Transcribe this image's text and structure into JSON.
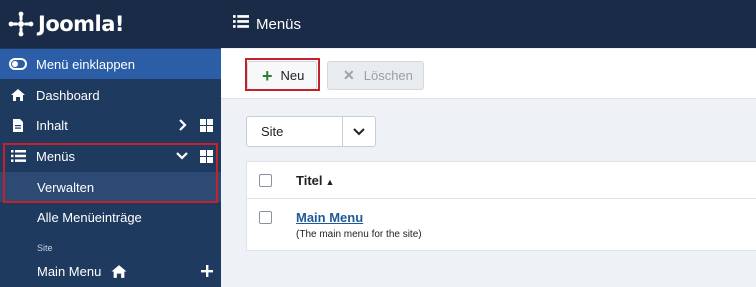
{
  "brand": {
    "name": "Joomla!"
  },
  "header": {
    "title": "Menüs"
  },
  "sidebar": {
    "items": [
      {
        "label": "Menü einklappen",
        "icon": "toggle-icon"
      },
      {
        "label": "Dashboard",
        "icon": "home-icon"
      },
      {
        "label": "Inhalt",
        "icon": "file-icon"
      },
      {
        "label": "Menüs",
        "icon": "list-icon"
      },
      {
        "label": "Verwalten"
      },
      {
        "label": "Alle Menüeinträge"
      }
    ],
    "section_label": "Site",
    "main_menu": {
      "label": "Main Menu"
    }
  },
  "toolbar": {
    "new_label": "Neu",
    "delete_label": "Löschen"
  },
  "filter": {
    "selected": "Site"
  },
  "table": {
    "column_title": "Titel",
    "rows": [
      {
        "title": "Main Menu",
        "description": "(The main menu for the site)"
      }
    ]
  },
  "colors": {
    "sidebar_bg": "#1f3a5f",
    "header_bg": "#1a2b47",
    "active_blue": "#2b5ea6",
    "highlight_red": "#c3222a",
    "link": "#1f5a96"
  }
}
